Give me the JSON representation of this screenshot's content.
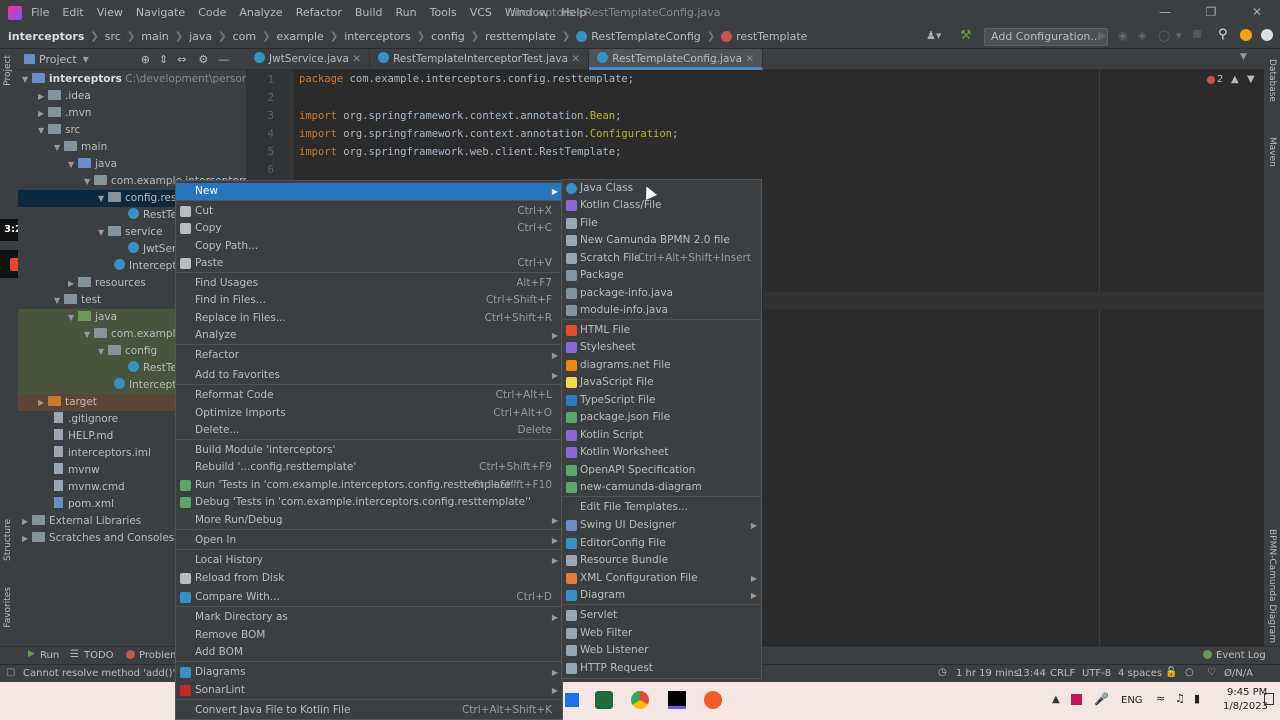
{
  "titlebar": {
    "menus": [
      "File",
      "Edit",
      "View",
      "Navigate",
      "Code",
      "Analyze",
      "Refactor",
      "Build",
      "Run",
      "Tools",
      "VCS",
      "Window",
      "Help"
    ],
    "title": "interceptors - RestTemplateConfig.java"
  },
  "navbar": {
    "crumbs": [
      "interceptors",
      "src",
      "main",
      "java",
      "com",
      "example",
      "interceptors",
      "config",
      "resttemplate",
      "RestTemplateConfig",
      "restTemplate"
    ],
    "add_config": "Add Configuration..."
  },
  "project": {
    "header": "Project",
    "root": "interceptors",
    "root_path": "C:\\development\\personal\\yo",
    "items": [
      ".idea",
      ".mvn",
      "src",
      "main",
      "java",
      "com.example.interceptors",
      "config.resttemplate",
      "RestTe",
      "service",
      "JwtServ",
      "Intercepto",
      "resources",
      "test",
      "java",
      "com.example.",
      "config",
      "RestTe",
      "Intercepto",
      "target",
      ".gitignore",
      "HELP.md",
      "interceptors.iml",
      "mvnw",
      "mvnw.cmd",
      "pom.xml",
      "External Libraries",
      "Scratches and Consoles"
    ]
  },
  "timer": "3:25",
  "tabs": [
    "JwtService.java",
    "RestTemplateInterceptorTest.java",
    "RestTemplateConfig.java"
  ],
  "editor": {
    "line_numbers": [
      "1",
      "2",
      "3",
      "4",
      "5",
      "6"
    ],
    "line1_kw": "package",
    "line1_rest": " com.example.interceptors.config.resttemplate;",
    "line3_kw": "import",
    "line3_rest": " org.springframework.context.annotation.",
    "line3_an": "Bean",
    "line4_kw": "import",
    "line4_rest": " org.springframework.context.annotation.",
    "line4_an": "Configuration",
    "line5_kw": "import",
    "line5_rest": " org.springframework.web.client.RestTemplate;",
    "errors": "2"
  },
  "context_menu": [
    {
      "label": "New",
      "shortcut": "",
      "sub": true,
      "hl": true
    },
    {
      "label": "Cut",
      "shortcut": "Ctrl+X"
    },
    {
      "label": "Copy",
      "shortcut": "Ctrl+C"
    },
    {
      "label": "Copy Path...",
      "shortcut": ""
    },
    {
      "label": "Paste",
      "shortcut": "Ctrl+V"
    },
    {
      "label": "Find Usages",
      "shortcut": "Alt+F7"
    },
    {
      "label": "Find in Files...",
      "shortcut": "Ctrl+Shift+F"
    },
    {
      "label": "Replace in Files...",
      "shortcut": "Ctrl+Shift+R"
    },
    {
      "label": "Analyze",
      "shortcut": "",
      "sub": true
    },
    {
      "label": "Refactor",
      "shortcut": "",
      "sub": true
    },
    {
      "label": "Add to Favorites",
      "shortcut": "",
      "sub": true
    },
    {
      "label": "Reformat Code",
      "shortcut": "Ctrl+Alt+L"
    },
    {
      "label": "Optimize Imports",
      "shortcut": "Ctrl+Alt+O"
    },
    {
      "label": "Delete...",
      "shortcut": "Delete"
    },
    {
      "label": "Build Module 'interceptors'",
      "shortcut": ""
    },
    {
      "label": "Rebuild '...config.resttemplate'",
      "shortcut": "Ctrl+Shift+F9"
    },
    {
      "label": "Run 'Tests in 'com.example.interceptors.config.resttemplate''",
      "shortcut": "Ctrl+Shift+F10"
    },
    {
      "label": "Debug 'Tests in 'com.example.interceptors.config.resttemplate''",
      "shortcut": ""
    },
    {
      "label": "More Run/Debug",
      "shortcut": "",
      "sub": true
    },
    {
      "label": "Open In",
      "shortcut": "",
      "sub": true
    },
    {
      "label": "Local History",
      "shortcut": "",
      "sub": true
    },
    {
      "label": "Reload from Disk",
      "shortcut": ""
    },
    {
      "label": "Compare With...",
      "shortcut": "Ctrl+D"
    },
    {
      "label": "Mark Directory as",
      "shortcut": "",
      "sub": true
    },
    {
      "label": "Remove BOM",
      "shortcut": ""
    },
    {
      "label": "Add BOM",
      "shortcut": ""
    },
    {
      "label": "Diagrams",
      "shortcut": "",
      "sub": true
    },
    {
      "label": "SonarLint",
      "shortcut": "",
      "sub": true
    },
    {
      "label": "Convert Java File to Kotlin File",
      "shortcut": "Ctrl+Alt+Shift+K"
    }
  ],
  "submenu": [
    {
      "label": "Java Class",
      "shortcut": ""
    },
    {
      "label": "Kotlin Class/File",
      "shortcut": ""
    },
    {
      "label": "File",
      "shortcut": ""
    },
    {
      "label": "New Camunda BPMN 2.0 file",
      "shortcut": ""
    },
    {
      "label": "Scratch File",
      "shortcut": "Ctrl+Alt+Shift+Insert"
    },
    {
      "label": "Package",
      "shortcut": ""
    },
    {
      "label": "package-info.java",
      "shortcut": ""
    },
    {
      "label": "module-info.java",
      "shortcut": ""
    },
    {
      "label": "HTML File",
      "shortcut": ""
    },
    {
      "label": "Stylesheet",
      "shortcut": ""
    },
    {
      "label": "diagrams.net File",
      "shortcut": ""
    },
    {
      "label": "JavaScript File",
      "shortcut": ""
    },
    {
      "label": "TypeScript File",
      "shortcut": ""
    },
    {
      "label": "package.json File",
      "shortcut": ""
    },
    {
      "label": "Kotlin Script",
      "shortcut": ""
    },
    {
      "label": "Kotlin Worksheet",
      "shortcut": ""
    },
    {
      "label": "OpenAPI Specification",
      "shortcut": ""
    },
    {
      "label": "new-camunda-diagram",
      "shortcut": ""
    },
    {
      "label": "Edit File Templates...",
      "shortcut": ""
    },
    {
      "label": "Swing UI Designer",
      "shortcut": "",
      "sub": true
    },
    {
      "label": "EditorConfig File",
      "shortcut": ""
    },
    {
      "label": "Resource Bundle",
      "shortcut": ""
    },
    {
      "label": "XML Configuration File",
      "shortcut": "",
      "sub": true
    },
    {
      "label": "Diagram",
      "shortcut": "",
      "sub": true
    },
    {
      "label": "Servlet",
      "shortcut": ""
    },
    {
      "label": "Web Filter",
      "shortcut": ""
    },
    {
      "label": "Web Listener",
      "shortcut": ""
    },
    {
      "label": "HTTP Request",
      "shortcut": ""
    }
  ],
  "bottom_tabs": [
    "Run",
    "TODO",
    "Problems"
  ],
  "status": {
    "message": "Cannot resolve method 'add()'",
    "time_spent": "1 hr 19 mins",
    "position": "13:44",
    "line_sep": "CRLF",
    "encoding": "UTF-8",
    "indent": "4 spaces",
    "na": "Ø/N/A",
    "event_log": "Event Log"
  },
  "right_strip": [
    "Database",
    "Maven",
    "BPMN-Camunda Diagram"
  ],
  "left_strip": [
    "Project",
    "Structure",
    "Favorites"
  ],
  "taskbar": {
    "lang": "ENG",
    "time": "9:45 PM",
    "date": "1/8/2023"
  }
}
